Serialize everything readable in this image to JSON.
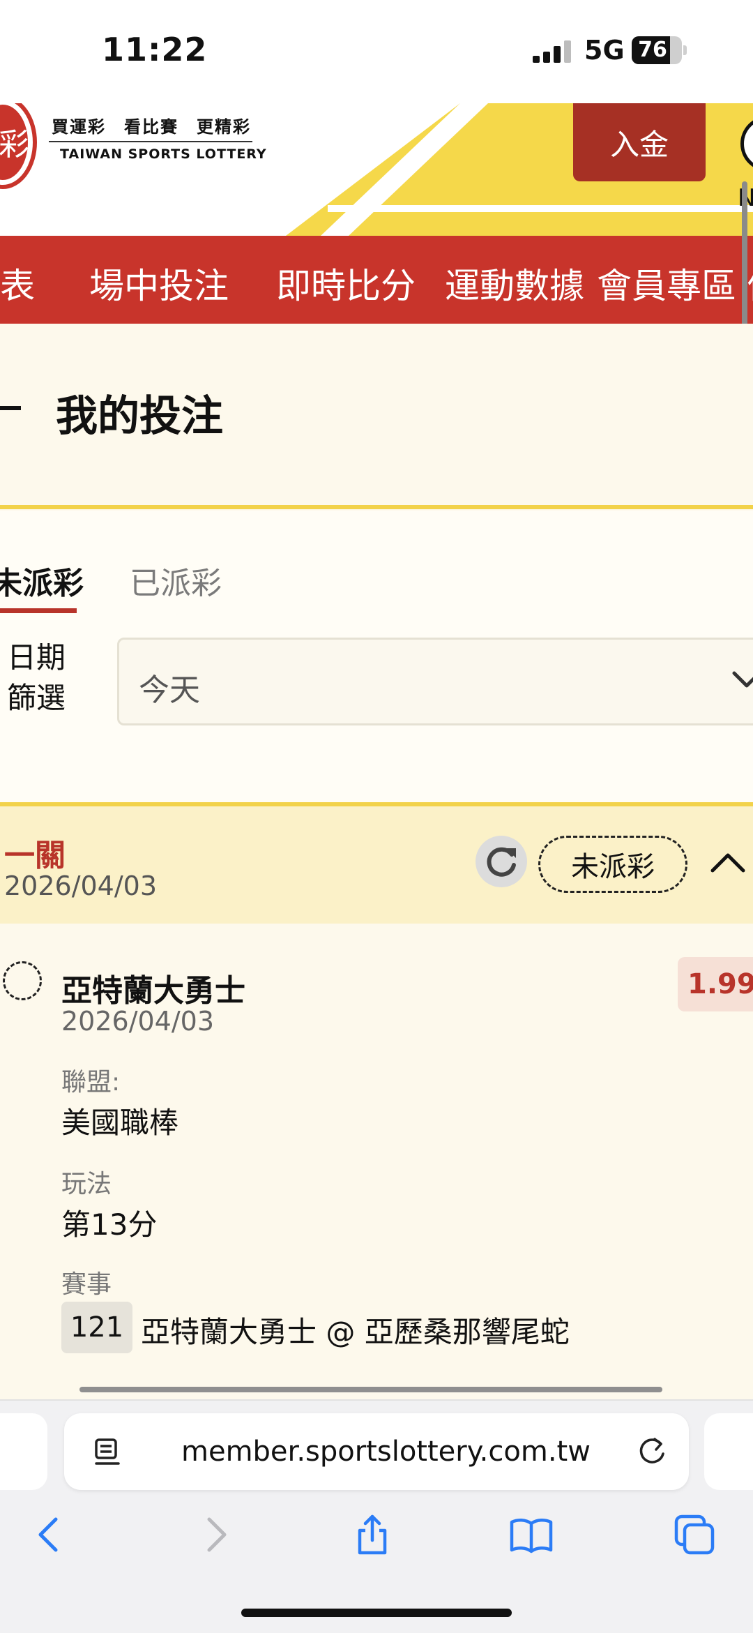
{
  "status_bar": {
    "time": "11:22",
    "network": "5G",
    "battery": "76",
    "battery_level": 0.76
  },
  "header": {
    "logo_glyph": "彩",
    "logo_slogan": "買運彩　看比賽　更精彩",
    "logo_english": "TAIWAN SPORTS LOTTERY",
    "deposit_label": "入金",
    "avatar_letter": "N"
  },
  "nav": {
    "items": [
      "賽表",
      "場中投注",
      "即時比分",
      "運動數據",
      "會員專區",
      "個"
    ]
  },
  "page": {
    "title": "我的投注"
  },
  "tabs": {
    "active": "未派彩",
    "inactive": "已派彩"
  },
  "filter": {
    "label_line1": "日期",
    "label_line2": "篩選",
    "value": "今天"
  },
  "bet": {
    "type": "一關",
    "date": "2026/04/03",
    "status": "未派彩",
    "selection": {
      "team": "亞特蘭大勇士",
      "date": "2026/04/03",
      "odds": "1.99",
      "league_label": "聯盟:",
      "league_value": "美國職棒",
      "play_label": "玩法",
      "play_value": "第13分",
      "event_label": "賽事",
      "event_code": "121",
      "event_name": "亞特蘭大勇士 @ 亞歷桑那響尾蛇"
    }
  },
  "browser": {
    "url": "member.sportslottery.com.tw"
  },
  "colors": {
    "brand_red": "#c8342b",
    "accent_yellow": "#f2d24a",
    "deposit_red": "#a63024",
    "odds_red": "#b8342a"
  }
}
